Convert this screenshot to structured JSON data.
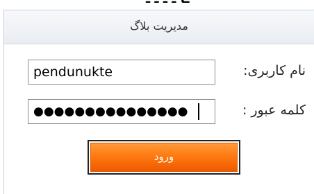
{
  "panel": {
    "title": "مدیریت بلاگ"
  },
  "form": {
    "username_label": "نام کاربری:",
    "username_value": "pendunukte",
    "password_label": "کلمه عبور :",
    "password_masked": "●●●●●●●●●●●●●●●",
    "login_label": "ورود"
  }
}
